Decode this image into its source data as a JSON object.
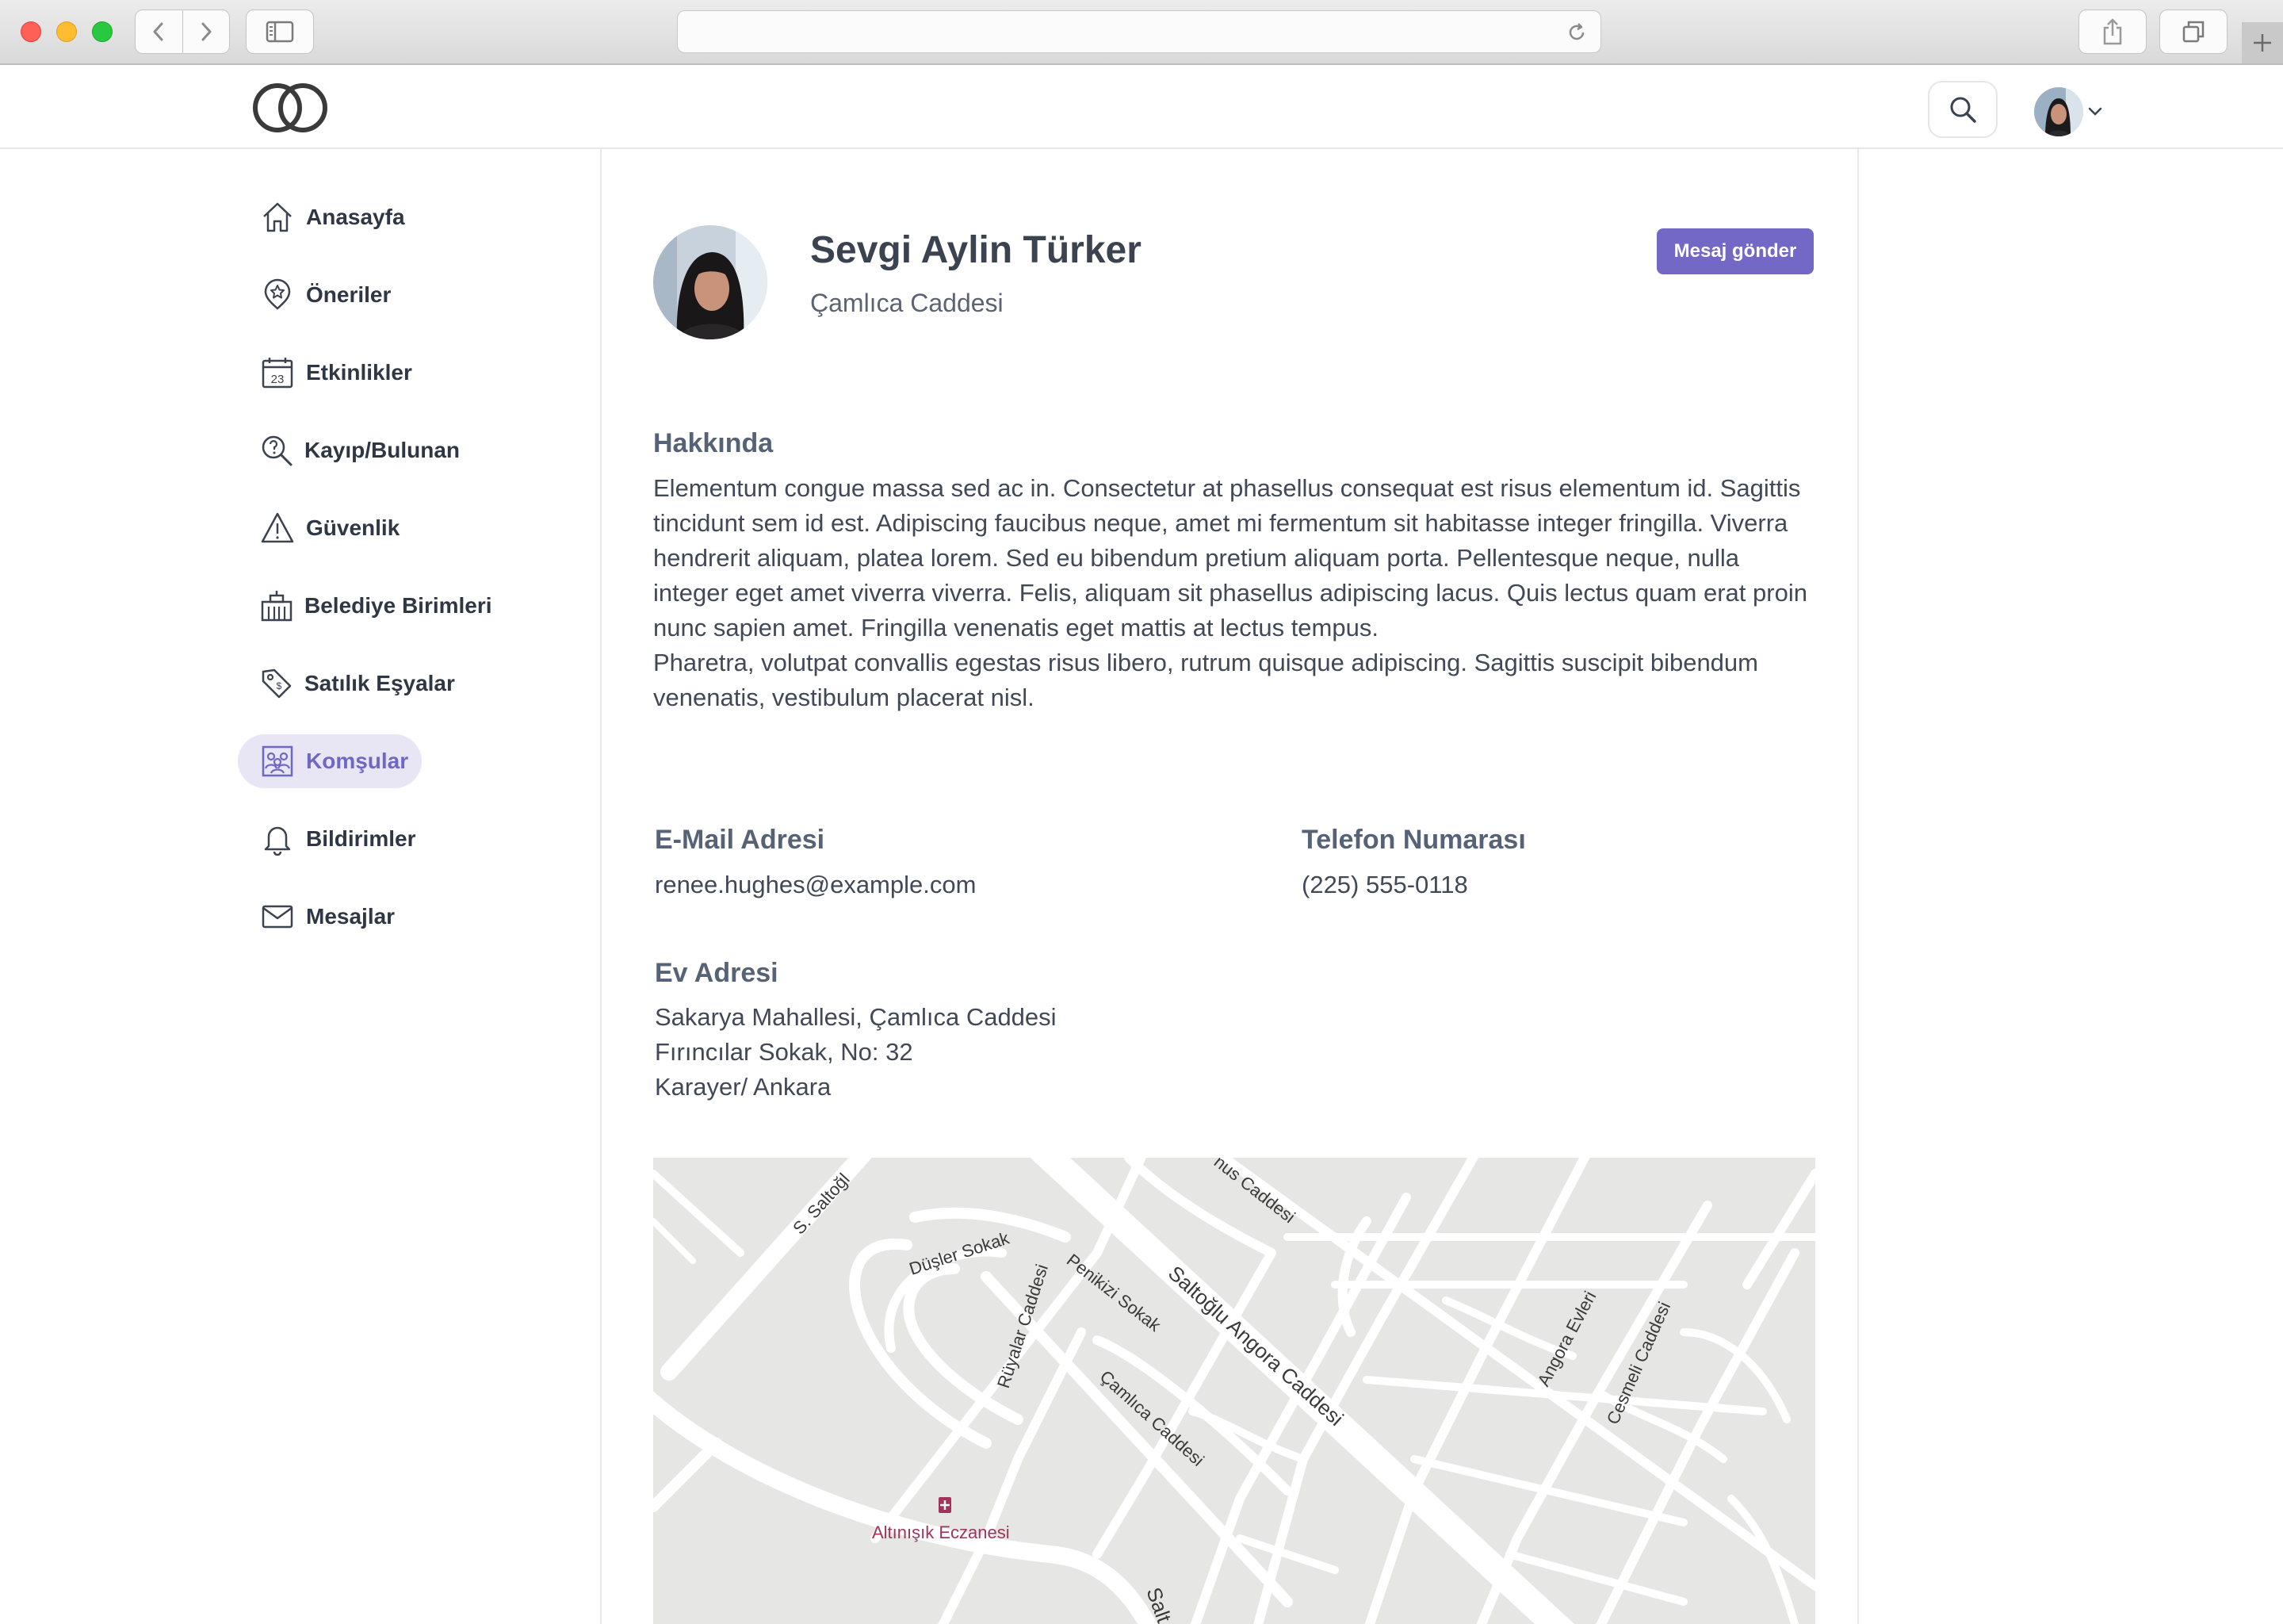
{
  "browser": {
    "url": ""
  },
  "header": {
    "logo_icon": "intersecting-rings-logo",
    "search_icon": "magnifier",
    "user_menu_icon": "chevron-down"
  },
  "sidebar": {
    "items": [
      {
        "label": "Anasayfa",
        "icon": "home-icon"
      },
      {
        "label": "Öneriler",
        "icon": "star-pin-icon"
      },
      {
        "label": "Etkinlikler",
        "icon": "calendar-icon",
        "day": "23"
      },
      {
        "label": "Kayıp/Bulunan",
        "icon": "search-question-icon"
      },
      {
        "label": "Güvenlik",
        "icon": "warning-icon"
      },
      {
        "label": "Belediye Birimleri",
        "icon": "building-icon"
      },
      {
        "label": "Satılık Eşyalar",
        "icon": "tag-icon"
      },
      {
        "label": "Komşular",
        "icon": "neighbors-icon",
        "active": true
      },
      {
        "label": "Bildirimler",
        "icon": "bell-icon"
      },
      {
        "label": "Mesajlar",
        "icon": "mail-icon"
      }
    ]
  },
  "profile": {
    "name": "Sevgi Aylin Türker",
    "street": "Çamlıca Caddesi",
    "send_message_label": "Mesaj gönder"
  },
  "about": {
    "title": "Hakkında",
    "paragraph1": "Elementum congue massa sed ac in. Consectetur at phasellus consequat est risus elementum id. Sagittis tincidunt sem id est. Adipiscing faucibus neque, amet mi fermentum sit habitasse integer fringilla. Viverra hendrerit aliquam, platea lorem. Sed eu bibendum pretium aliquam porta. Pellentesque neque, nulla integer eget amet viverra viverra. Felis, aliquam sit phasellus adipiscing lacus. Quis lectus quam erat proin nunc sapien amet. Fringilla venenatis eget mattis at lectus tempus.",
    "paragraph2": "Pharetra, volutpat convallis egestas risus libero, rutrum quisque adipiscing. Sagittis suscipit bibendum venenatis, vestibulum placerat nisl."
  },
  "contact": {
    "email_title": "E-Mail Adresi",
    "email": "renee.hughes@example.com",
    "phone_title": "Telefon Numarası",
    "phone": "(225) 555-0118",
    "address_title": "Ev Adresi",
    "address_line1": "Sakarya Mahallesi, Çamlıca Caddesi",
    "address_line2": "Fırıncılar Sokak, No: 32",
    "address_line3": "Karayer/ Ankara"
  },
  "map": {
    "labels": {
      "s_saltogl": "S. Saltoğl",
      "yunus": "nus Caddesi",
      "dusler": "Düşler Sokak",
      "ruyalar": "Rüyalar Caddesi",
      "penikizi": "Penikizi Sokak",
      "saltoglu_angora": "Saltoğlu Angora Caddesi",
      "camlica": "Çamlıca Caddesi",
      "angora_evleri": "Angora Evleri",
      "cesmeli": "Cesmeli Caddesi",
      "pharmacy": "Altınışık Eczanesi",
      "salt": "Salt"
    },
    "pharmacy_icon": "pharmacy-icon",
    "pharmacy_color": "#a0345a"
  },
  "colors": {
    "accent": "#7368c6",
    "active_bg": "#e8e6f5"
  }
}
